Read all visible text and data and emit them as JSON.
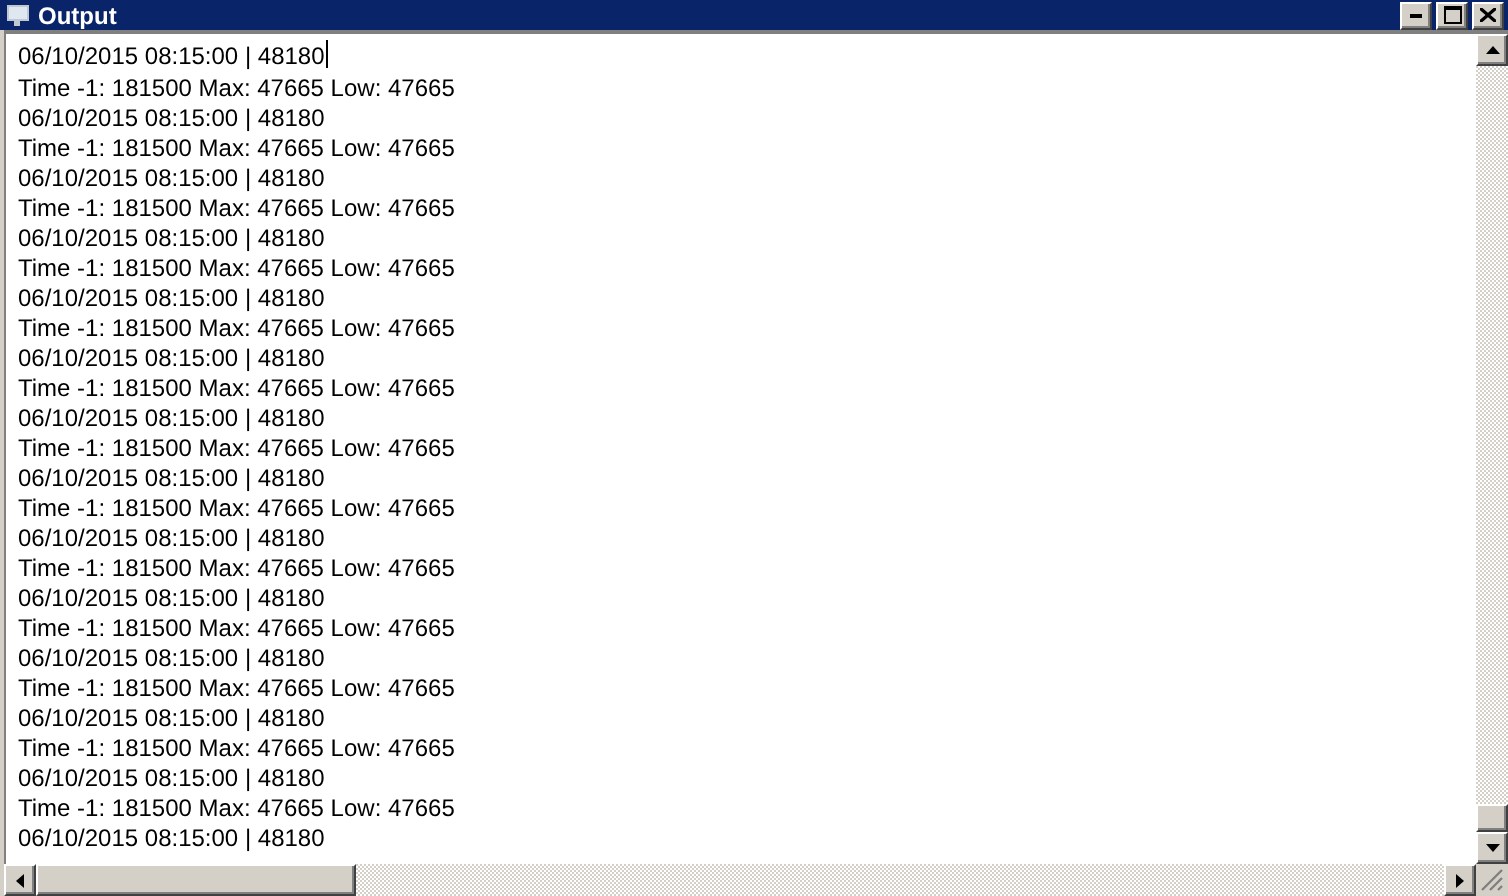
{
  "window": {
    "title": "Output"
  },
  "output": {
    "lines": [
      "06/10/2015 08:15:00 | 48180",
      "Time -1: 181500 Max: 47665 Low: 47665",
      "06/10/2015 08:15:00 | 48180",
      "Time -1: 181500 Max: 47665 Low: 47665",
      "06/10/2015 08:15:00 | 48180",
      "Time -1: 181500 Max: 47665 Low: 47665",
      "06/10/2015 08:15:00 | 48180",
      "Time -1: 181500 Max: 47665 Low: 47665",
      "06/10/2015 08:15:00 | 48180",
      "Time -1: 181500 Max: 47665 Low: 47665",
      "06/10/2015 08:15:00 | 48180",
      "Time -1: 181500 Max: 47665 Low: 47665",
      "06/10/2015 08:15:00 | 48180",
      "Time -1: 181500 Max: 47665 Low: 47665",
      "06/10/2015 08:15:00 | 48180",
      "Time -1: 181500 Max: 47665 Low: 47665",
      "06/10/2015 08:15:00 | 48180",
      "Time -1: 181500 Max: 47665 Low: 47665",
      "06/10/2015 08:15:00 | 48180",
      "Time -1: 181500 Max: 47665 Low: 47665",
      "06/10/2015 08:15:00 | 48180",
      "Time -1: 181500 Max: 47665 Low: 47665",
      "06/10/2015 08:15:00 | 48180",
      "Time -1: 181500 Max: 47665 Low: 47665",
      "06/10/2015 08:15:00 | 48180",
      "Time -1: 181500 Max: 47665 Low: 47665",
      "06/10/2015 08:15:00 | 48180"
    ]
  }
}
